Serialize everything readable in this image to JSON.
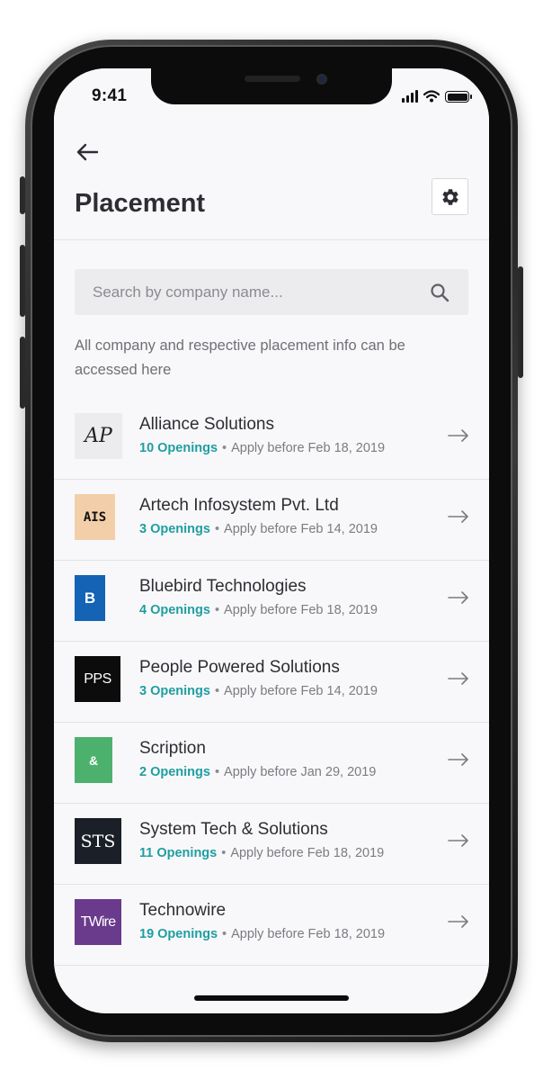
{
  "status_bar": {
    "time": "9:41"
  },
  "header": {
    "title": "Placement"
  },
  "search": {
    "placeholder": "Search by company name..."
  },
  "description": "All company and respective placement info can be accessed here",
  "companies": [
    {
      "logo_text": "AP",
      "name": "Alliance Solutions",
      "openings": "10 Openings",
      "apply": "Apply before Feb 18, 2019"
    },
    {
      "logo_text": "AIS",
      "name": "Artech Infosystem Pvt. Ltd",
      "openings": "3 Openings",
      "apply": "Apply before Feb 14, 2019"
    },
    {
      "logo_text": "B",
      "name": "Bluebird Technologies",
      "openings": "4 Openings",
      "apply": "Apply before Feb 18, 2019"
    },
    {
      "logo_text": "PPS",
      "name": "People Powered Solutions",
      "openings": "3 Openings",
      "apply": "Apply before Feb 14, 2019"
    },
    {
      "logo_text": "&",
      "name": "Scription",
      "openings": "2 Openings",
      "apply": "Apply before Jan 29, 2019"
    },
    {
      "logo_text": "STS",
      "name": "System Tech & Solutions",
      "openings": "11 Openings",
      "apply": "Apply before Feb 18, 2019"
    },
    {
      "logo_text": "TWire",
      "name": "Technowire",
      "openings": "19 Openings",
      "apply": "Apply before Feb 18, 2019"
    }
  ],
  "colors": {
    "accent": "#1f9ea0",
    "logo_backgrounds": [
      "#ececee",
      "#f3cfa9",
      "#1463b4",
      "#0c0c0c",
      "#4cb16c",
      "#1b2028",
      "#6a3a8c"
    ]
  }
}
